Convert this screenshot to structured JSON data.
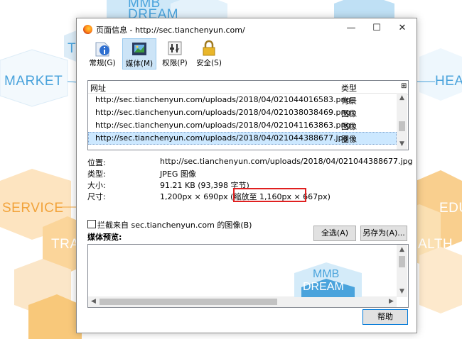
{
  "background": {
    "texts": {
      "mmb_top": "MMB",
      "dream_top": "DREAM",
      "market": "MARKET",
      "service": "SERVICE",
      "t1": "T",
      "tra": "TRA",
      "hea": "HEA",
      "edu": "EDU",
      "alth": "ALTH",
      "mmb_mid": "MMB",
      "dream_mid": "DREAM"
    },
    "colors": {
      "blue": "#4aa3dc",
      "orange": "#f2a33a",
      "light_orange": "#f8c87a"
    }
  },
  "window": {
    "title": "页面信息 - http://sec.tianchenyun.com/",
    "controls": {
      "minimize": "—",
      "maximize": "☐",
      "close": "✕"
    }
  },
  "toolbar": {
    "tabs": [
      {
        "label": "常规(G)",
        "icon": "info-icon"
      },
      {
        "label": "媒体(M)",
        "icon": "media-icon"
      },
      {
        "label": "权限(P)",
        "icon": "permissions-icon"
      },
      {
        "label": "安全(S)",
        "icon": "lock-icon"
      }
    ],
    "selected": "媒体(M)"
  },
  "media_list": {
    "headers": {
      "address": "网址",
      "type": "类型",
      "picker": "⊞"
    },
    "rows": [
      {
        "url": "http://sec.tianchenyun.com/uploads/2018/04/021044016583.png",
        "type": "背景"
      },
      {
        "url": "http://sec.tianchenyun.com/uploads/2018/04/021038038469.png",
        "type": "图像"
      },
      {
        "url": "http://sec.tianchenyun.com/uploads/2018/04/021041163863.png",
        "type": "图像"
      },
      {
        "url": "http://sec.tianchenyun.com/uploads/2018/04/021044388677.jpg",
        "type": "图像"
      }
    ],
    "selected_row": 3
  },
  "properties": {
    "location_label": "位置:",
    "location_value": "http://sec.tianchenyun.com/uploads/2018/04/021044388677.jpg",
    "type_label": "类型:",
    "type_value": "JPEG 图像",
    "size_label": "大小:",
    "size_value": "91.21 KB (93,398 字节)",
    "dimensions_label": "尺寸:",
    "dimensions_value_a": "1,200px × 690px (缩放",
    "dimensions_value_b": "至 1,160px × 667px)"
  },
  "block_checkbox": {
    "label": "拦截来自 sec.tianchenyun.com 的图像(B)",
    "checked": false
  },
  "preview_label": "媒体预览:",
  "buttons": {
    "select_all": "全选(A)",
    "save_as": "另存为(A)...",
    "help": "帮助"
  }
}
